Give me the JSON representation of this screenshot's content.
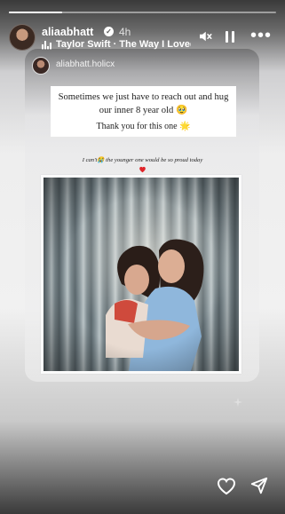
{
  "story": {
    "progress": 0.2,
    "username": "aliaabhatt",
    "verified_icon": "verified-badge-icon",
    "time": "4h",
    "song": "Taylor Swift · The Way I Loved Y",
    "icons": [
      "music-bars-icon",
      "mute-icon",
      "pause-icon",
      "more-icon"
    ]
  },
  "shared_post": {
    "username": "aliabhatt.holicx",
    "quote_lines": [
      "Sometimes we just have to reach out and hug",
      "our inner 8 year old 🥹",
      "Thank you for this one 🌟"
    ],
    "caption": "I can't😭 the younger one would be so proud today",
    "caption_emoji": "❤️"
  },
  "reply_bar": {
    "icons": [
      "heart-icon",
      "send-icon"
    ]
  },
  "colors": {
    "text_light": "#ffffff",
    "quote_bg": "#ffffff",
    "heart_red": "#e0252a"
  }
}
